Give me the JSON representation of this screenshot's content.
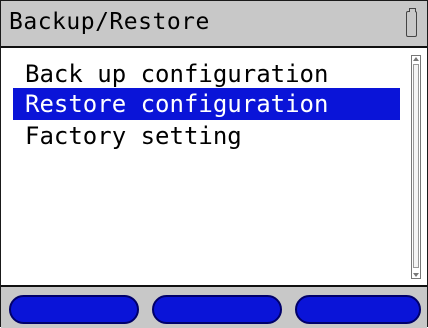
{
  "header": {
    "title": "Backup/Restore",
    "battery_icon": "battery-icon"
  },
  "menu": {
    "items": [
      {
        "label": "Back up configuration",
        "selected": false
      },
      {
        "label": "Restore configuration",
        "selected": true
      },
      {
        "label": "Factory setting",
        "selected": false
      }
    ]
  },
  "softkeys": [
    {
      "label": ""
    },
    {
      "label": ""
    },
    {
      "label": ""
    }
  ],
  "colors": {
    "selection": "#0a14d8",
    "bar_background": "#c8c8c8",
    "softkey": "#0a14d8"
  }
}
